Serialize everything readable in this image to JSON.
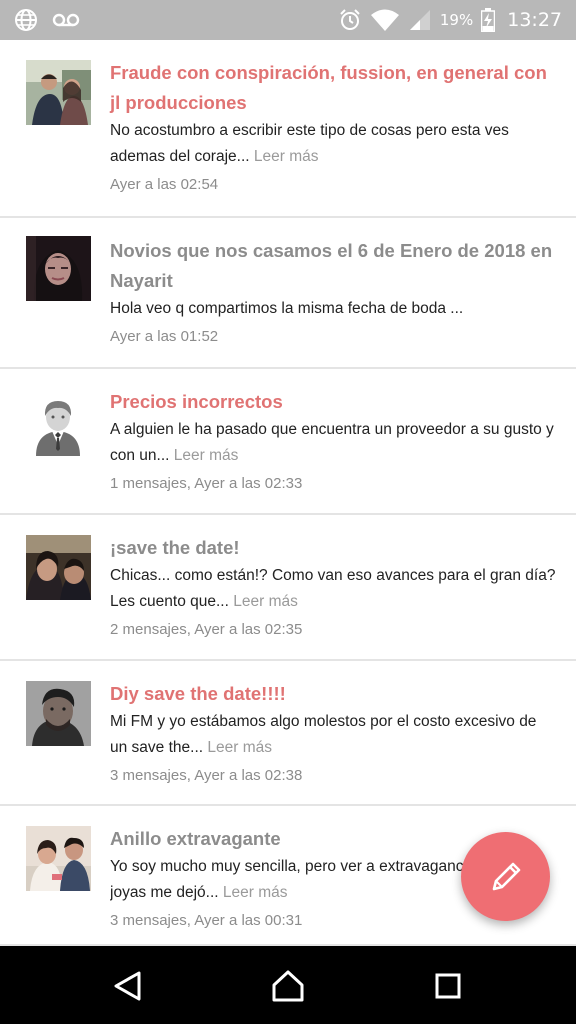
{
  "status_bar": {
    "icons": [
      "globe-icon",
      "voicemail-icon",
      "alarm-icon",
      "wifi-icon",
      "signal-icon",
      "battery-charging-icon"
    ],
    "battery": "19%",
    "time": "13:27"
  },
  "posts": [
    {
      "title": "Fraude con conspiración, fussion, en general con jl producciones",
      "title_color": "#e07373",
      "excerpt_line1": "No acostumbro a escribir este tipo de cosas pero esta ves",
      "excerpt_line2": "ademas del coraje...",
      "more": "Leer más",
      "meta": "Ayer a las 02:54",
      "avatar": "couple-photo"
    },
    {
      "title": "Novios que nos casamos el 6 de Enero de 2018 en Nayarit",
      "title_color": "#8c8c8c",
      "excerpt_line1": "Hola veo q compartimos la misma fecha de boda ...",
      "excerpt_line2": "",
      "more": "",
      "meta": "Ayer a las 01:52",
      "avatar": "woman-photo"
    },
    {
      "title": "Precios incorrectos",
      "title_color": "#e07373",
      "excerpt_line1": "A alguien le ha pasado que encuentra un proveedor a su gusto y",
      "excerpt_line2": "con un...",
      "more": "Leer más",
      "meta": "1 mensajes, Ayer a las 02:33",
      "avatar": "groom-placeholder"
    },
    {
      "title": "¡save the date!",
      "title_color": "#8c8c8c",
      "excerpt_line1": "Chicas... como están!? Como van eso avances para el gran día?",
      "excerpt_line2": "Les cuento que...",
      "more": "Leer más",
      "meta": "2 mensajes, Ayer a las 02:35",
      "avatar": "couple-selfie"
    },
    {
      "title": "Diy save the date!!!!",
      "title_color": "#e07373",
      "excerpt_line1": "Mi FM y yo estábamos algo molestos por el costo excesivo de",
      "excerpt_line2": "un save the...",
      "more": "Leer más",
      "meta": "3 mensajes, Ayer a las 02:38",
      "avatar": "man-photo"
    },
    {
      "title": "Anillo extravagante",
      "title_color": "#8c8c8c",
      "excerpt_line1": "Yo soy mucho muy sencilla, pero ver a extravaganci",
      "excerpt_line2": "joyas me dejó...",
      "more": "Leer más",
      "meta": "3 mensajes, Ayer a las 00:31",
      "avatar": "couple-photo-2"
    }
  ],
  "fab": {
    "icon": "pencil-icon",
    "color": "#ef6e73"
  },
  "nav_bar": {
    "icons": [
      "back-icon",
      "home-icon",
      "recents-icon"
    ]
  },
  "colors": {
    "accent": "#e07373",
    "muted": "#8c8c8c",
    "status_bar": "#b8b8b8"
  }
}
